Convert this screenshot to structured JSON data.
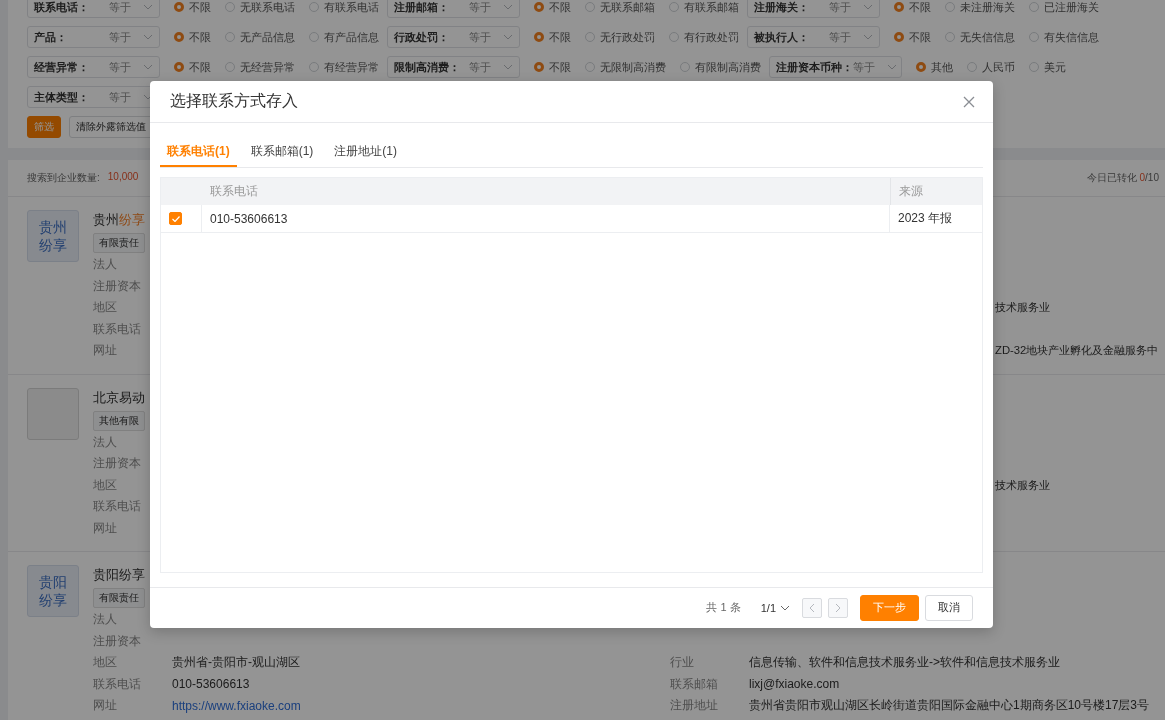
{
  "filters": [
    [
      {
        "label": "联系电话：",
        "operator": "等于",
        "options": [
          {
            "label": "不限",
            "selected": true
          },
          {
            "label": "无联系电话",
            "selected": false
          },
          {
            "label": "有联系电话",
            "selected": false
          }
        ]
      },
      {
        "label": "注册邮箱：",
        "operator": "等于",
        "options": [
          {
            "label": "不限",
            "selected": true
          },
          {
            "label": "无联系邮箱",
            "selected": false
          },
          {
            "label": "有联系邮箱",
            "selected": false
          }
        ]
      },
      {
        "label": "注册海关：",
        "operator": "等于",
        "options": [
          {
            "label": "不限",
            "selected": true
          },
          {
            "label": "未注册海关",
            "selected": false
          },
          {
            "label": "已注册海关",
            "selected": false
          }
        ]
      }
    ],
    [
      {
        "label": "产品：",
        "operator": "等于",
        "options": [
          {
            "label": "不限",
            "selected": true
          },
          {
            "label": "无产品信息",
            "selected": false
          },
          {
            "label": "有产品信息",
            "selected": false
          }
        ]
      },
      {
        "label": "行政处罚：",
        "operator": "等于",
        "options": [
          {
            "label": "不限",
            "selected": true
          },
          {
            "label": "无行政处罚",
            "selected": false
          },
          {
            "label": "有行政处罚",
            "selected": false
          }
        ]
      },
      {
        "label": "被执行人：",
        "operator": "等于",
        "options": [
          {
            "label": "不限",
            "selected": true
          },
          {
            "label": "无失信信息",
            "selected": false
          },
          {
            "label": "有失信信息",
            "selected": false
          }
        ]
      }
    ],
    [
      {
        "label": "经营异常：",
        "operator": "等于",
        "options": [
          {
            "label": "不限",
            "selected": true
          },
          {
            "label": "无经营异常",
            "selected": false
          },
          {
            "label": "有经营异常",
            "selected": false
          }
        ]
      },
      {
        "label": "限制高消费：",
        "operator": "等于",
        "options": [
          {
            "label": "不限",
            "selected": true
          },
          {
            "label": "无限制高消费",
            "selected": false
          },
          {
            "label": "有限制高消费",
            "selected": false
          }
        ]
      },
      {
        "label": "注册资本币种：",
        "operator": "等于",
        "options": [
          {
            "label": "其他",
            "selected": true
          },
          {
            "label": "人民币",
            "selected": false
          },
          {
            "label": "美元",
            "selected": false
          }
        ]
      }
    ],
    [
      {
        "label": "主体类型：",
        "operator": "等于"
      }
    ]
  ],
  "filter_buttons": [
    {
      "label": "筛选",
      "kind": "primary"
    },
    {
      "label": "清除外露筛选值",
      "kind": "default"
    }
  ],
  "results": {
    "count_label": "搜索到企业数量:",
    "count": "10,000",
    "converted_label": "今日已转化",
    "converted_count": "0",
    "converted_total": "/10"
  },
  "companies": [
    {
      "logo": {
        "kind": "text",
        "text": "贵州纷享"
      },
      "name": [
        {
          "text": "贵州",
          "highlight": false
        },
        {
          "text": "纷享",
          "highlight": true
        }
      ],
      "tag": "有限责任",
      "rows": [
        {
          "label": "法人"
        },
        {
          "label": "注册资本"
        },
        {
          "label": "地区",
          "right_value": "技术服务业"
        },
        {
          "label": "联系电话"
        },
        {
          "label": "网址",
          "right_value": "ZD-32地块产业孵化及金融服务中"
        }
      ]
    },
    {
      "logo": {
        "kind": "image"
      },
      "name": [
        {
          "text": "北京易动",
          "highlight": false
        }
      ],
      "tag": "其他有限",
      "rows": [
        {
          "label": "法人"
        },
        {
          "label": "注册资本"
        },
        {
          "label": "地区",
          "right_value": "技术服务业"
        },
        {
          "label": "联系电话"
        },
        {
          "label": "网址"
        }
      ]
    },
    {
      "logo": {
        "kind": "text",
        "text": "贵阳纷享"
      },
      "name": [
        {
          "text": "贵阳纷享",
          "highlight": false
        }
      ],
      "tag": "有限责任",
      "rows": [
        {
          "label": "法人"
        },
        {
          "label": "注册资本"
        },
        {
          "label": "地区",
          "value": "贵州省-贵阳市-观山湖区",
          "right_label": "行业",
          "right_value": "信息传输、软件和信息技术服务业->软件和信息技术服务业"
        },
        {
          "label": "联系电话",
          "value": "010-53606613",
          "right_label": "联系邮箱",
          "right_value": "lixj@fxiaoke.com"
        },
        {
          "label": "网址",
          "value": "https://www.fxiaoke.com",
          "link": true,
          "right_label": "注册地址",
          "right_value": "贵州省贵阳市观山湖区长岭街道贵阳国际金融中心1期商务区10号楼17层3号"
        }
      ]
    }
  ],
  "dialog": {
    "title": "选择联系方式存入",
    "tabs": [
      {
        "label": "联系电话(1)",
        "selected": true
      },
      {
        "label": "联系邮箱(1)",
        "selected": false
      },
      {
        "label": "注册地址(1)",
        "selected": false
      }
    ],
    "table": {
      "columns": [
        "联系电话",
        "来源"
      ],
      "rows": [
        {
          "checked": true,
          "cells": [
            "010-53606613",
            "2023 年报"
          ]
        }
      ]
    },
    "total": "共 1 条",
    "page": "1/1",
    "buttons": [
      {
        "label": "下一步",
        "kind": "primary"
      },
      {
        "label": "取消",
        "kind": "default"
      }
    ]
  }
}
